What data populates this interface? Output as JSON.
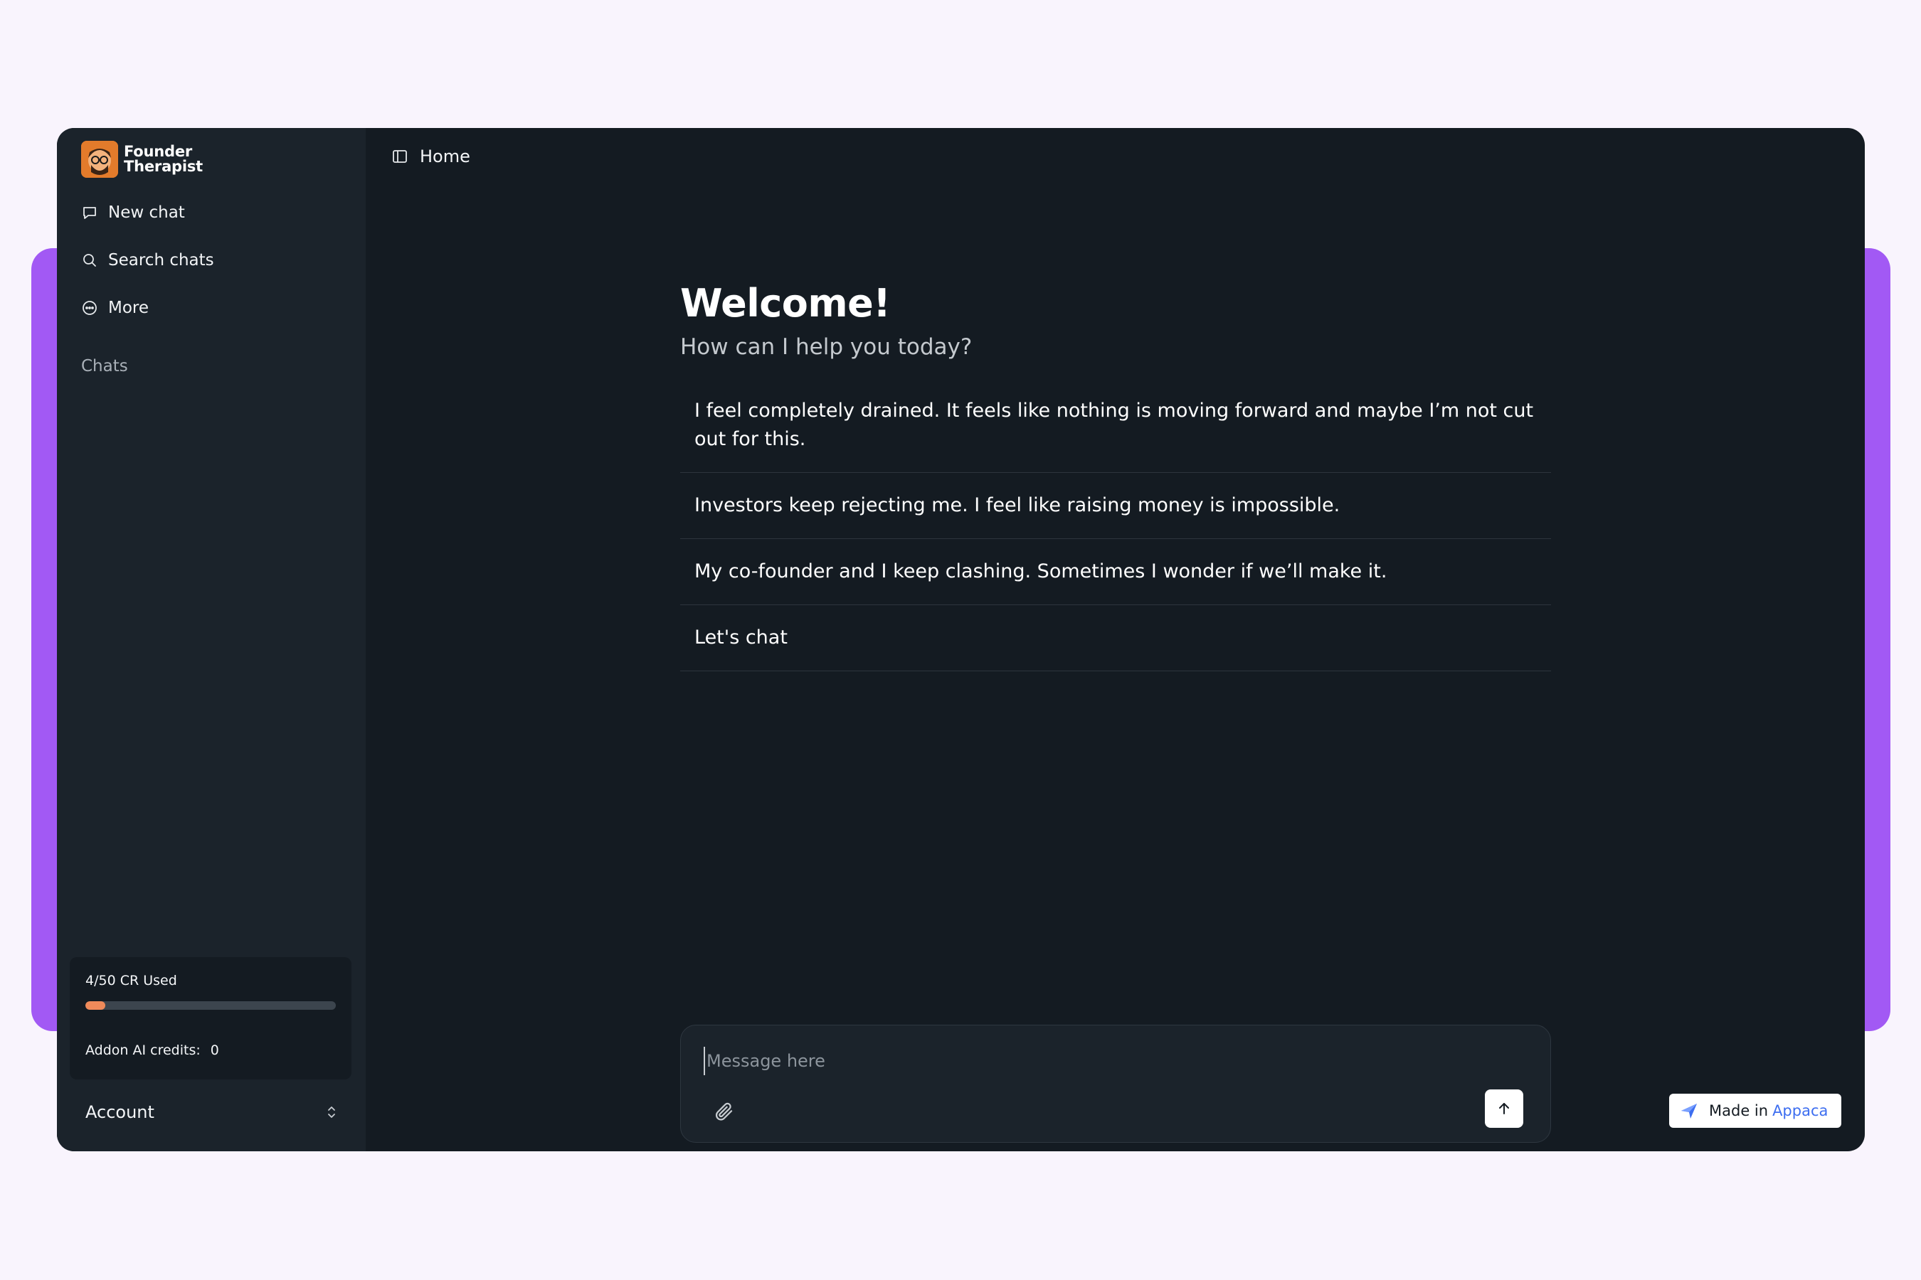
{
  "brand": {
    "line1": "Founder",
    "line2": "Therapist"
  },
  "sidebar": {
    "items": [
      {
        "label": "New chat",
        "icon": "chat-bubble-icon"
      },
      {
        "label": "Search chats",
        "icon": "search-icon"
      },
      {
        "label": "More",
        "icon": "more-circle-icon"
      }
    ],
    "chats_heading": "Chats",
    "credits": {
      "used_label": "4/50 CR Used",
      "used": 4,
      "total": 50,
      "addon_label": "Addon AI credits:",
      "addon_value": "0"
    },
    "account_label": "Account"
  },
  "header": {
    "breadcrumb": "Home"
  },
  "main": {
    "title": "Welcome!",
    "subtitle": "How can I help you today?",
    "suggestions": [
      "I feel completely drained. It feels like nothing is moving forward and maybe I’m not cut out for this.",
      "Investors keep rejecting me. I feel like raising money is impossible.",
      "My co-founder and I keep clashing. Sometimes I wonder if we’ll make it.",
      "Let's chat"
    ]
  },
  "composer": {
    "placeholder": "Message here"
  },
  "badge": {
    "prefix": "Made in",
    "brand": "Appaca"
  },
  "colors": {
    "accent_purple": "#a259f4",
    "progress_orange": "#ef8a5a",
    "app_bg": "#141b22",
    "sidebar_bg": "#1b232b"
  }
}
